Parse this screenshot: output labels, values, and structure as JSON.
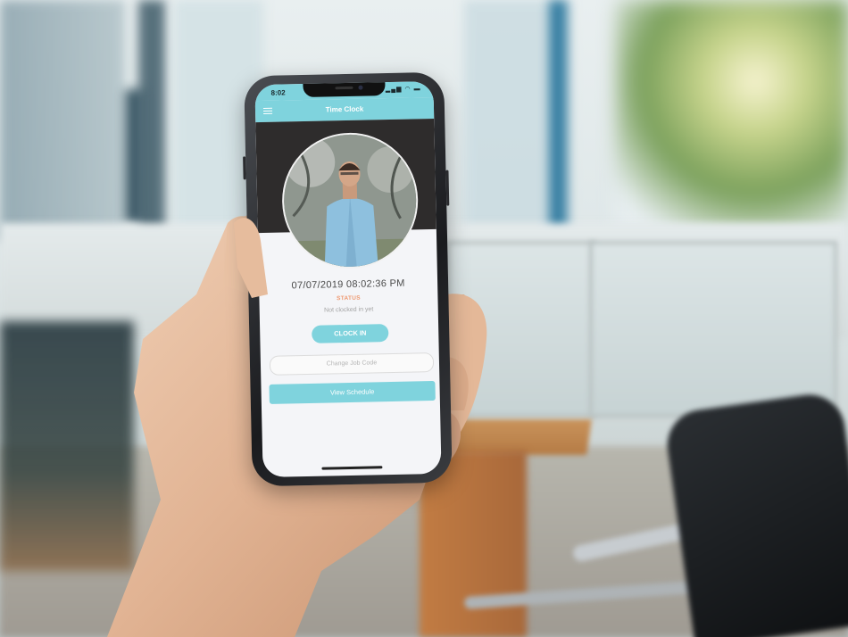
{
  "statusbar": {
    "time": "8:02"
  },
  "appbar": {
    "title": "Time Clock"
  },
  "clock": {
    "datetime": "07/07/2019 08:02:36 PM",
    "status_label": "STATUS",
    "status_value": "Not clocked in yet",
    "clock_in_label": "CLOCK IN",
    "job_code_placeholder": "Change Job Code",
    "schedule_label": "View Schedule"
  },
  "colors": {
    "accent": "#7fd3dd",
    "status": "#ef9a72",
    "photo_band": "#2e2c2c"
  },
  "icons": [
    "menu-icon",
    "signal-icon",
    "wifi-icon",
    "battery-icon"
  ]
}
